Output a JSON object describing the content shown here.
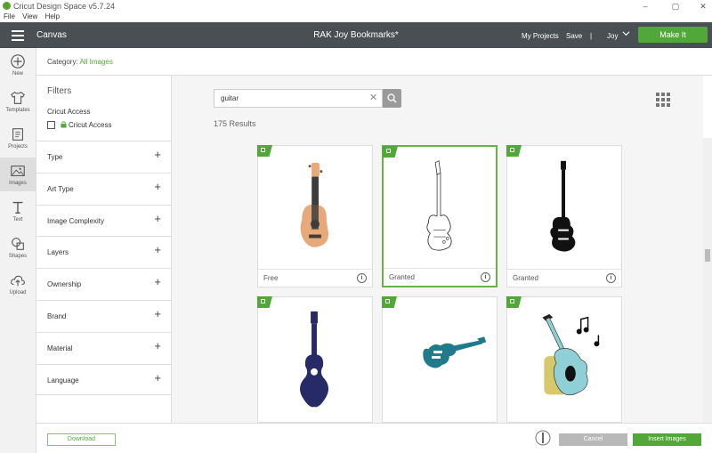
{
  "window": {
    "title": "Cricut Design Space  v5.7.24",
    "controls": [
      "–",
      "▢",
      "✕"
    ]
  },
  "menu": [
    "File",
    "View",
    "Help"
  ],
  "header": {
    "canvas_label": "Canvas",
    "project_title": "RAK Joy Bookmarks*",
    "my_projects": "My Projects",
    "save": "Save",
    "separator": "|",
    "user": "Joy",
    "make_it": "Make It"
  },
  "leftnav": [
    {
      "label": "New",
      "icon": "plus-circle-icon"
    },
    {
      "label": "Templates",
      "icon": "shirt-icon"
    },
    {
      "label": "Projects",
      "icon": "projects-icon"
    },
    {
      "label": "Images",
      "icon": "image-icon",
      "active": true
    },
    {
      "label": "Text",
      "icon": "text-icon"
    },
    {
      "label": "Shapes",
      "icon": "shapes-icon"
    },
    {
      "label": "Upload",
      "icon": "cloud-upload-icon"
    }
  ],
  "category": {
    "prefix": "Category:",
    "value": "All Images"
  },
  "filters": {
    "heading": "Filters",
    "cricut_access_title": "Cricut Access",
    "cricut_access_checkbox": "Cricut Access",
    "facets": [
      "Type",
      "Art Type",
      "Image Complexity",
      "Layers",
      "Ownership",
      "Brand",
      "Material",
      "Language"
    ],
    "expand_symbol": "+"
  },
  "search": {
    "value": "guitar",
    "clear": "✕"
  },
  "results": "175 Results",
  "cards": [
    {
      "status": "Free",
      "art": "ukulele",
      "selected": false
    },
    {
      "status": "Granted",
      "art": "electric-guitar-sketch",
      "selected": true
    },
    {
      "status": "Granted",
      "art": "bass-guitar-silhouette",
      "selected": false
    },
    {
      "status": "",
      "art": "acoustic-guitar-navy",
      "selected": false
    },
    {
      "status": "",
      "art": "electric-guitar-teal",
      "selected": false
    },
    {
      "status": "",
      "art": "guitar-music-notes",
      "selected": false
    }
  ],
  "footer": {
    "download": "Download",
    "cancel": "Cancel",
    "insert": "Insert Images"
  },
  "colors": {
    "accent": "#51a838",
    "header": "#4a4f54"
  }
}
